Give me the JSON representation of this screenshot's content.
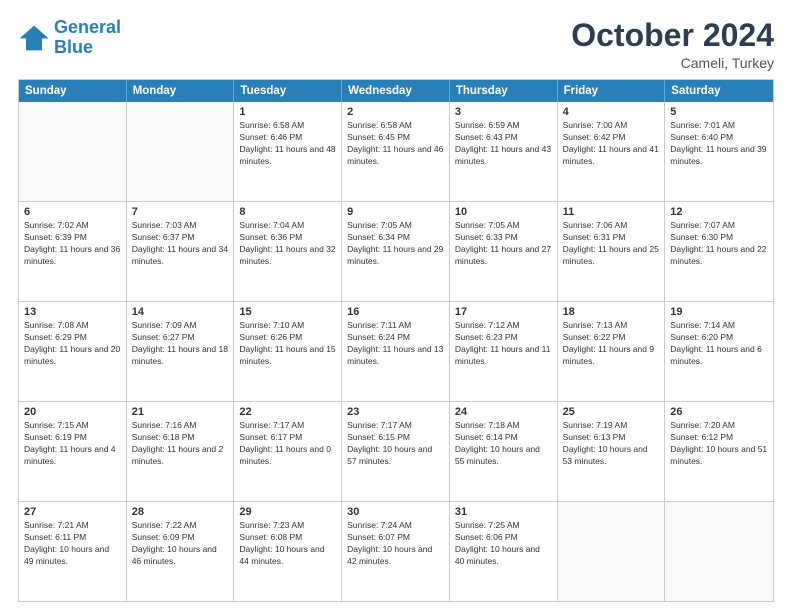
{
  "logo": {
    "line1": "General",
    "line2": "Blue"
  },
  "title": "October 2024",
  "subtitle": "Cameli, Turkey",
  "header_days": [
    "Sunday",
    "Monday",
    "Tuesday",
    "Wednesday",
    "Thursday",
    "Friday",
    "Saturday"
  ],
  "rows": [
    [
      {
        "day": "",
        "content": "",
        "empty": true
      },
      {
        "day": "",
        "content": "",
        "empty": true
      },
      {
        "day": "1",
        "content": "Sunrise: 6:58 AM\nSunset: 6:46 PM\nDaylight: 11 hours and 48 minutes."
      },
      {
        "day": "2",
        "content": "Sunrise: 6:58 AM\nSunset: 6:45 PM\nDaylight: 11 hours and 46 minutes."
      },
      {
        "day": "3",
        "content": "Sunrise: 6:59 AM\nSunset: 6:43 PM\nDaylight: 11 hours and 43 minutes."
      },
      {
        "day": "4",
        "content": "Sunrise: 7:00 AM\nSunset: 6:42 PM\nDaylight: 11 hours and 41 minutes."
      },
      {
        "day": "5",
        "content": "Sunrise: 7:01 AM\nSunset: 6:40 PM\nDaylight: 11 hours and 39 minutes."
      }
    ],
    [
      {
        "day": "6",
        "content": "Sunrise: 7:02 AM\nSunset: 6:39 PM\nDaylight: 11 hours and 36 minutes."
      },
      {
        "day": "7",
        "content": "Sunrise: 7:03 AM\nSunset: 6:37 PM\nDaylight: 11 hours and 34 minutes."
      },
      {
        "day": "8",
        "content": "Sunrise: 7:04 AM\nSunset: 6:36 PM\nDaylight: 11 hours and 32 minutes."
      },
      {
        "day": "9",
        "content": "Sunrise: 7:05 AM\nSunset: 6:34 PM\nDaylight: 11 hours and 29 minutes."
      },
      {
        "day": "10",
        "content": "Sunrise: 7:05 AM\nSunset: 6:33 PM\nDaylight: 11 hours and 27 minutes."
      },
      {
        "day": "11",
        "content": "Sunrise: 7:06 AM\nSunset: 6:31 PM\nDaylight: 11 hours and 25 minutes."
      },
      {
        "day": "12",
        "content": "Sunrise: 7:07 AM\nSunset: 6:30 PM\nDaylight: 11 hours and 22 minutes."
      }
    ],
    [
      {
        "day": "13",
        "content": "Sunrise: 7:08 AM\nSunset: 6:29 PM\nDaylight: 11 hours and 20 minutes."
      },
      {
        "day": "14",
        "content": "Sunrise: 7:09 AM\nSunset: 6:27 PM\nDaylight: 11 hours and 18 minutes."
      },
      {
        "day": "15",
        "content": "Sunrise: 7:10 AM\nSunset: 6:26 PM\nDaylight: 11 hours and 15 minutes."
      },
      {
        "day": "16",
        "content": "Sunrise: 7:11 AM\nSunset: 6:24 PM\nDaylight: 11 hours and 13 minutes."
      },
      {
        "day": "17",
        "content": "Sunrise: 7:12 AM\nSunset: 6:23 PM\nDaylight: 11 hours and 11 minutes."
      },
      {
        "day": "18",
        "content": "Sunrise: 7:13 AM\nSunset: 6:22 PM\nDaylight: 11 hours and 9 minutes."
      },
      {
        "day": "19",
        "content": "Sunrise: 7:14 AM\nSunset: 6:20 PM\nDaylight: 11 hours and 6 minutes."
      }
    ],
    [
      {
        "day": "20",
        "content": "Sunrise: 7:15 AM\nSunset: 6:19 PM\nDaylight: 11 hours and 4 minutes."
      },
      {
        "day": "21",
        "content": "Sunrise: 7:16 AM\nSunset: 6:18 PM\nDaylight: 11 hours and 2 minutes."
      },
      {
        "day": "22",
        "content": "Sunrise: 7:17 AM\nSunset: 6:17 PM\nDaylight: 11 hours and 0 minutes."
      },
      {
        "day": "23",
        "content": "Sunrise: 7:17 AM\nSunset: 6:15 PM\nDaylight: 10 hours and 57 minutes."
      },
      {
        "day": "24",
        "content": "Sunrise: 7:18 AM\nSunset: 6:14 PM\nDaylight: 10 hours and 55 minutes."
      },
      {
        "day": "25",
        "content": "Sunrise: 7:19 AM\nSunset: 6:13 PM\nDaylight: 10 hours and 53 minutes."
      },
      {
        "day": "26",
        "content": "Sunrise: 7:20 AM\nSunset: 6:12 PM\nDaylight: 10 hours and 51 minutes."
      }
    ],
    [
      {
        "day": "27",
        "content": "Sunrise: 7:21 AM\nSunset: 6:11 PM\nDaylight: 10 hours and 49 minutes."
      },
      {
        "day": "28",
        "content": "Sunrise: 7:22 AM\nSunset: 6:09 PM\nDaylight: 10 hours and 46 minutes."
      },
      {
        "day": "29",
        "content": "Sunrise: 7:23 AM\nSunset: 6:08 PM\nDaylight: 10 hours and 44 minutes."
      },
      {
        "day": "30",
        "content": "Sunrise: 7:24 AM\nSunset: 6:07 PM\nDaylight: 10 hours and 42 minutes."
      },
      {
        "day": "31",
        "content": "Sunrise: 7:25 AM\nSunset: 6:06 PM\nDaylight: 10 hours and 40 minutes."
      },
      {
        "day": "",
        "content": "",
        "empty": true
      },
      {
        "day": "",
        "content": "",
        "empty": true
      }
    ]
  ]
}
